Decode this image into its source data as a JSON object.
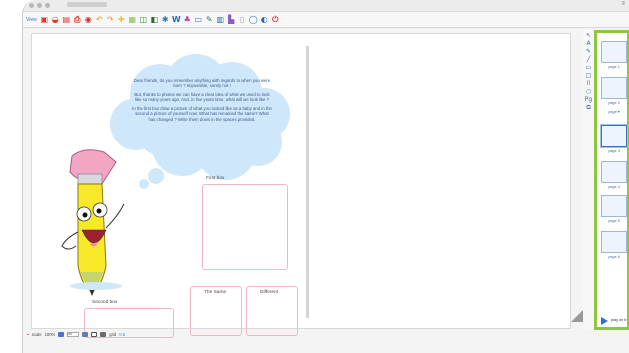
{
  "window": {
    "title_menu": "≡"
  },
  "toolbar": {
    "view_label": "View",
    "tools": [
      {
        "name": "new-page-icon",
        "glyph": "▣",
        "color": "#e0362a"
      },
      {
        "name": "open-icon",
        "glyph": "◒",
        "color": "#e0362a"
      },
      {
        "name": "save-icon",
        "glyph": "▤",
        "color": "#d5312a"
      },
      {
        "name": "print-icon",
        "glyph": "⎙",
        "color": "#d5312a"
      },
      {
        "name": "screen-capture-icon",
        "glyph": "◉",
        "color": "#c8312b"
      },
      {
        "name": "undo-icon",
        "glyph": "↶",
        "color": "#f2a74a"
      },
      {
        "name": "redo-icon",
        "glyph": "↷",
        "color": "#f2a74a"
      },
      {
        "name": "zoom-icon",
        "glyph": "✚",
        "color": "#f0c040"
      },
      {
        "name": "gallery-icon",
        "glyph": "▦",
        "color": "#8ac046"
      },
      {
        "name": "layout-icon",
        "glyph": "◫",
        "color": "#3d8a3d"
      },
      {
        "name": "film-icon",
        "glyph": "◧",
        "color": "#2e6b2e"
      },
      {
        "name": "flash-icon",
        "glyph": "✱",
        "color": "#2f7a9e"
      },
      {
        "name": "word-icon",
        "glyph": "W",
        "color": "#2a68b6"
      },
      {
        "name": "person-icon",
        "glyph": "♣",
        "color": "#c23f9f"
      },
      {
        "name": "window-icon",
        "glyph": "▭",
        "color": "#2a68b6"
      },
      {
        "name": "tools-icon",
        "glyph": "✎",
        "color": "#2d7a5c"
      },
      {
        "name": "calendar-icon",
        "glyph": "▥",
        "color": "#2a68b6"
      },
      {
        "name": "chart-icon",
        "glyph": "▙",
        "color": "#8e5bbf"
      },
      {
        "name": "document-icon",
        "glyph": "▯",
        "color": "#9aa3ad"
      },
      {
        "name": "speech-bubble-icon",
        "glyph": "◯",
        "color": "#2a68b6"
      },
      {
        "name": "pointer-icon",
        "glyph": "◐",
        "color": "#2a68b6"
      },
      {
        "name": "power-icon",
        "glyph": "⏻",
        "color": "#d92f2f"
      }
    ]
  },
  "page": {
    "cloud_paragraphs": [
      "Dear friends, do you remember anything with regards to when you were born ? Impossible, surely not !",
      "But, thanks to photos we can have a clear idea of what we used to look like so many years ago. And, in five years time, what will we look like ?",
      "In the first box draw a picture of what you looked like as a baby and in the second a picture of yourself now. What has remained the same? What has changed ? Write them down in the spaces provided."
    ],
    "first_box_label": "First box",
    "second_box_label": "Second box",
    "same_label": "The Same",
    "different_label": "Different"
  },
  "right_tools": [
    {
      "name": "select-arrow-icon",
      "glyph": "↖"
    },
    {
      "name": "text-tool-icon",
      "glyph": "A"
    },
    {
      "name": "pen-icon",
      "glyph": "✎"
    },
    {
      "name": "line-icon",
      "glyph": "╱"
    },
    {
      "name": "rectangle-icon",
      "glyph": "▭"
    },
    {
      "name": "square-icon",
      "glyph": "□"
    },
    {
      "name": "cylinder-icon",
      "glyph": "⌷"
    },
    {
      "name": "circle-icon",
      "glyph": "○"
    },
    {
      "name": "page-tool-icon",
      "glyph": "Pg"
    },
    {
      "name": "group-icon",
      "glyph": "⧉"
    }
  ],
  "thumbnails": [
    {
      "label": "page 1",
      "selected": false
    },
    {
      "label": "page 2",
      "selected": false
    },
    {
      "label": "page 3",
      "selected": true
    },
    {
      "label": "page 4",
      "selected": false
    },
    {
      "label": "page 5",
      "selected": false
    },
    {
      "label": "page 6",
      "selected": false
    }
  ],
  "thumb_toolbar": "page ▾",
  "play": {
    "label": "play on b"
  },
  "status": {
    "scale_label": "scale",
    "scale_value": "100%",
    "page_value": "ex",
    "grid_label": "grid",
    "grid_value": "0.5"
  },
  "colors": {
    "thumb_border": "#8dc63f",
    "cloud": "#cfe7fb",
    "pencil_body": "#f7e92a",
    "pencil_eraser": "#f3a6c4"
  }
}
